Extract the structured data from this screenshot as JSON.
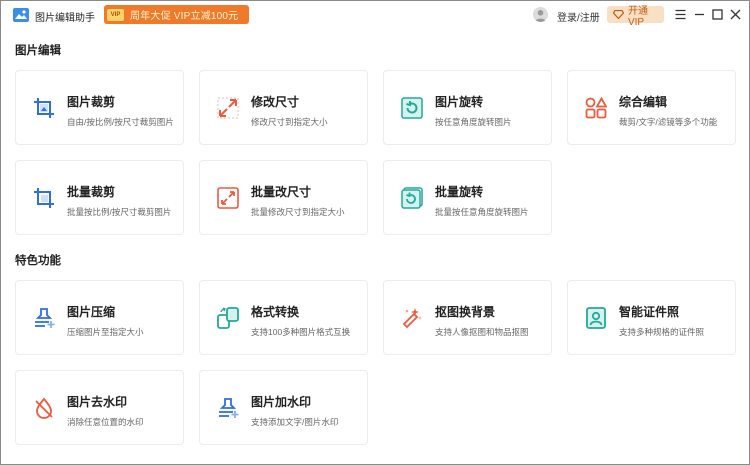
{
  "app": {
    "title": "图片编辑助手"
  },
  "promo": {
    "badge": "VIP",
    "text": "周年大促 VIP立减100元"
  },
  "header": {
    "login_label": "登录/注册",
    "vip_label": "开通VIP"
  },
  "colors": {
    "accent_orange": "#f07a2a",
    "icon_blue": "#2f6fe4",
    "icon_red": "#ef5a3c",
    "icon_teal": "#23a99a"
  },
  "sections": [
    {
      "title": "图片编辑",
      "cards": [
        {
          "icon": "crop-icon",
          "title": "图片裁剪",
          "desc": "自由/按比例/按尺寸裁剪图片"
        },
        {
          "icon": "resize-icon",
          "title": "修改尺寸",
          "desc": "修改尺寸到指定大小"
        },
        {
          "icon": "rotate-icon",
          "title": "图片旋转",
          "desc": "按任意角度旋转图片"
        },
        {
          "icon": "shapes-icon",
          "title": "综合编辑",
          "desc": "裁剪/文字/滤镜等多个功能"
        },
        {
          "icon": "batch-crop-icon",
          "title": "批量裁剪",
          "desc": "批量按比例/按尺寸裁剪图片"
        },
        {
          "icon": "batch-resize-icon",
          "title": "批量改尺寸",
          "desc": "批量修改尺寸到指定大小"
        },
        {
          "icon": "batch-rotate-icon",
          "title": "批量旋转",
          "desc": "批量按任意角度旋转图片"
        }
      ]
    },
    {
      "title": "特色功能",
      "cards": [
        {
          "icon": "compress-icon",
          "title": "图片压缩",
          "desc": "压缩图片至指定大小"
        },
        {
          "icon": "convert-icon",
          "title": "格式转换",
          "desc": "支持100多种图片格式互换"
        },
        {
          "icon": "cutout-icon",
          "title": "抠图换背景",
          "desc": "支持人像抠图和物品抠图"
        },
        {
          "icon": "id-photo-icon",
          "title": "智能证件照",
          "desc": "支持多种规格的证件照"
        },
        {
          "icon": "remove-watermark-icon",
          "title": "图片去水印",
          "desc": "消除任意位置的水印"
        },
        {
          "icon": "add-watermark-icon",
          "title": "图片加水印",
          "desc": "支持添加文字/图片水印"
        }
      ]
    }
  ]
}
